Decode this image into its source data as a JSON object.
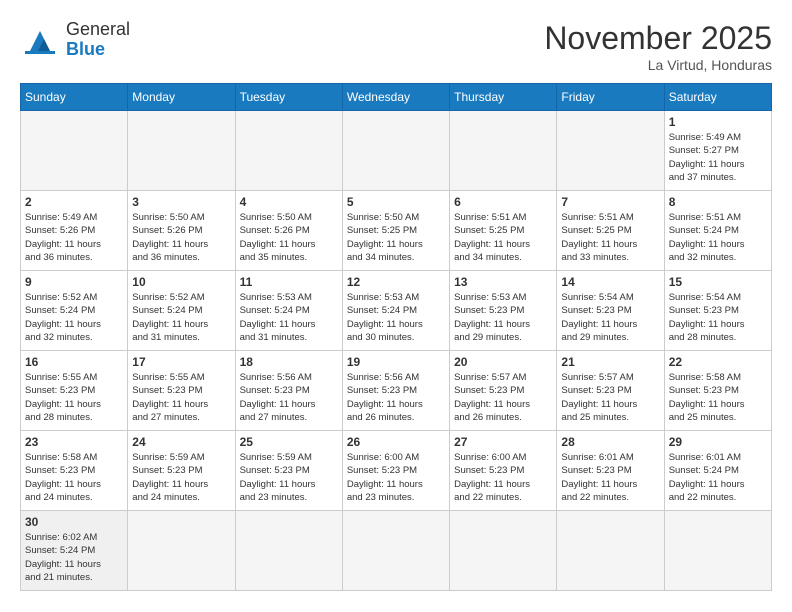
{
  "header": {
    "logo_general": "General",
    "logo_blue": "Blue",
    "month_title": "November 2025",
    "location": "La Virtud, Honduras"
  },
  "days_of_week": [
    "Sunday",
    "Monday",
    "Tuesday",
    "Wednesday",
    "Thursday",
    "Friday",
    "Saturday"
  ],
  "weeks": [
    {
      "days": [
        {
          "number": "",
          "info": ""
        },
        {
          "number": "",
          "info": ""
        },
        {
          "number": "",
          "info": ""
        },
        {
          "number": "",
          "info": ""
        },
        {
          "number": "",
          "info": ""
        },
        {
          "number": "",
          "info": ""
        },
        {
          "number": "1",
          "info": "Sunrise: 5:49 AM\nSunset: 5:27 PM\nDaylight: 11 hours\nand 37 minutes."
        }
      ]
    },
    {
      "days": [
        {
          "number": "2",
          "info": "Sunrise: 5:49 AM\nSunset: 5:26 PM\nDaylight: 11 hours\nand 36 minutes."
        },
        {
          "number": "3",
          "info": "Sunrise: 5:50 AM\nSunset: 5:26 PM\nDaylight: 11 hours\nand 36 minutes."
        },
        {
          "number": "4",
          "info": "Sunrise: 5:50 AM\nSunset: 5:26 PM\nDaylight: 11 hours\nand 35 minutes."
        },
        {
          "number": "5",
          "info": "Sunrise: 5:50 AM\nSunset: 5:25 PM\nDaylight: 11 hours\nand 34 minutes."
        },
        {
          "number": "6",
          "info": "Sunrise: 5:51 AM\nSunset: 5:25 PM\nDaylight: 11 hours\nand 34 minutes."
        },
        {
          "number": "7",
          "info": "Sunrise: 5:51 AM\nSunset: 5:25 PM\nDaylight: 11 hours\nand 33 minutes."
        },
        {
          "number": "8",
          "info": "Sunrise: 5:51 AM\nSunset: 5:24 PM\nDaylight: 11 hours\nand 32 minutes."
        }
      ]
    },
    {
      "days": [
        {
          "number": "9",
          "info": "Sunrise: 5:52 AM\nSunset: 5:24 PM\nDaylight: 11 hours\nand 32 minutes."
        },
        {
          "number": "10",
          "info": "Sunrise: 5:52 AM\nSunset: 5:24 PM\nDaylight: 11 hours\nand 31 minutes."
        },
        {
          "number": "11",
          "info": "Sunrise: 5:53 AM\nSunset: 5:24 PM\nDaylight: 11 hours\nand 31 minutes."
        },
        {
          "number": "12",
          "info": "Sunrise: 5:53 AM\nSunset: 5:24 PM\nDaylight: 11 hours\nand 30 minutes."
        },
        {
          "number": "13",
          "info": "Sunrise: 5:53 AM\nSunset: 5:23 PM\nDaylight: 11 hours\nand 29 minutes."
        },
        {
          "number": "14",
          "info": "Sunrise: 5:54 AM\nSunset: 5:23 PM\nDaylight: 11 hours\nand 29 minutes."
        },
        {
          "number": "15",
          "info": "Sunrise: 5:54 AM\nSunset: 5:23 PM\nDaylight: 11 hours\nand 28 minutes."
        }
      ]
    },
    {
      "days": [
        {
          "number": "16",
          "info": "Sunrise: 5:55 AM\nSunset: 5:23 PM\nDaylight: 11 hours\nand 28 minutes."
        },
        {
          "number": "17",
          "info": "Sunrise: 5:55 AM\nSunset: 5:23 PM\nDaylight: 11 hours\nand 27 minutes."
        },
        {
          "number": "18",
          "info": "Sunrise: 5:56 AM\nSunset: 5:23 PM\nDaylight: 11 hours\nand 27 minutes."
        },
        {
          "number": "19",
          "info": "Sunrise: 5:56 AM\nSunset: 5:23 PM\nDaylight: 11 hours\nand 26 minutes."
        },
        {
          "number": "20",
          "info": "Sunrise: 5:57 AM\nSunset: 5:23 PM\nDaylight: 11 hours\nand 26 minutes."
        },
        {
          "number": "21",
          "info": "Sunrise: 5:57 AM\nSunset: 5:23 PM\nDaylight: 11 hours\nand 25 minutes."
        },
        {
          "number": "22",
          "info": "Sunrise: 5:58 AM\nSunset: 5:23 PM\nDaylight: 11 hours\nand 25 minutes."
        }
      ]
    },
    {
      "days": [
        {
          "number": "23",
          "info": "Sunrise: 5:58 AM\nSunset: 5:23 PM\nDaylight: 11 hours\nand 24 minutes."
        },
        {
          "number": "24",
          "info": "Sunrise: 5:59 AM\nSunset: 5:23 PM\nDaylight: 11 hours\nand 24 minutes."
        },
        {
          "number": "25",
          "info": "Sunrise: 5:59 AM\nSunset: 5:23 PM\nDaylight: 11 hours\nand 23 minutes."
        },
        {
          "number": "26",
          "info": "Sunrise: 6:00 AM\nSunset: 5:23 PM\nDaylight: 11 hours\nand 23 minutes."
        },
        {
          "number": "27",
          "info": "Sunrise: 6:00 AM\nSunset: 5:23 PM\nDaylight: 11 hours\nand 22 minutes."
        },
        {
          "number": "28",
          "info": "Sunrise: 6:01 AM\nSunset: 5:23 PM\nDaylight: 11 hours\nand 22 minutes."
        },
        {
          "number": "29",
          "info": "Sunrise: 6:01 AM\nSunset: 5:24 PM\nDaylight: 11 hours\nand 22 minutes."
        }
      ]
    },
    {
      "days": [
        {
          "number": "30",
          "info": "Sunrise: 6:02 AM\nSunset: 5:24 PM\nDaylight: 11 hours\nand 21 minutes."
        },
        {
          "number": "",
          "info": ""
        },
        {
          "number": "",
          "info": ""
        },
        {
          "number": "",
          "info": ""
        },
        {
          "number": "",
          "info": ""
        },
        {
          "number": "",
          "info": ""
        },
        {
          "number": "",
          "info": ""
        }
      ]
    }
  ]
}
